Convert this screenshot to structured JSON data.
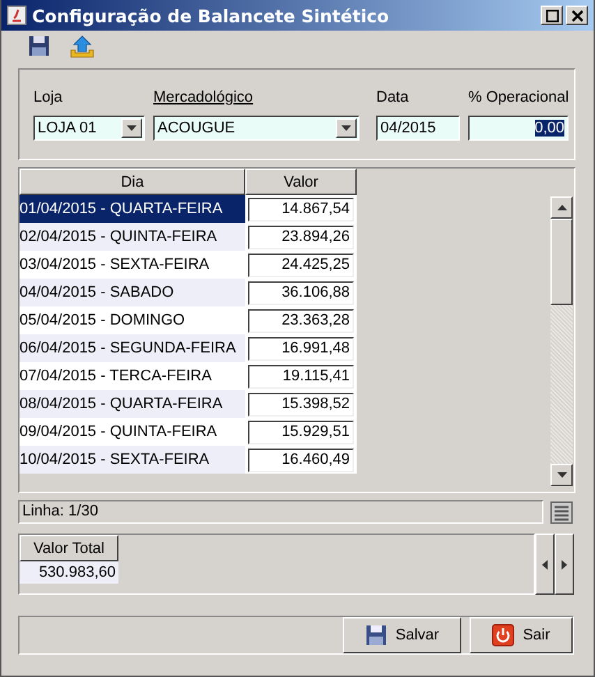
{
  "window": {
    "title": "Configuração de Balancete Sintético"
  },
  "filters": {
    "loja": {
      "label": "Loja",
      "value": "LOJA 01"
    },
    "mercadologico": {
      "label": "Mercadológico",
      "value": "ACOUGUE"
    },
    "data": {
      "label": "Data",
      "value": "04/2015"
    },
    "operacional": {
      "label": "% Operacional",
      "value": "0,00"
    }
  },
  "table": {
    "columns": [
      "Dia",
      "Valor"
    ],
    "rows": [
      {
        "dia": "01/04/2015 - QUARTA-FEIRA",
        "valor": "14.867,54",
        "selected": true
      },
      {
        "dia": "02/04/2015 - QUINTA-FEIRA",
        "valor": "23.894,26",
        "selected": false
      },
      {
        "dia": "03/04/2015 - SEXTA-FEIRA",
        "valor": "24.425,25",
        "selected": false
      },
      {
        "dia": "04/04/2015 - SABADO",
        "valor": "36.106,88",
        "selected": false
      },
      {
        "dia": "05/04/2015 - DOMINGO",
        "valor": "23.363,28",
        "selected": false
      },
      {
        "dia": "06/04/2015 - SEGUNDA-FEIRA",
        "valor": "16.991,48",
        "selected": false
      },
      {
        "dia": "07/04/2015 - TERCA-FEIRA",
        "valor": "19.115,41",
        "selected": false
      },
      {
        "dia": "08/04/2015 - QUARTA-FEIRA",
        "valor": "15.398,52",
        "selected": false
      },
      {
        "dia": "09/04/2015 - QUINTA-FEIRA",
        "valor": "15.929,51",
        "selected": false
      },
      {
        "dia": "10/04/2015 - SEXTA-FEIRA",
        "valor": "16.460,49",
        "selected": false
      }
    ]
  },
  "status_bar": {
    "text": "Linha: 1/30"
  },
  "totals": {
    "column": "Valor Total",
    "value": "530.983,60"
  },
  "buttons": [
    {
      "kind": "save",
      "label": "Salvar"
    },
    {
      "kind": "exit",
      "label": "Sair"
    }
  ]
}
